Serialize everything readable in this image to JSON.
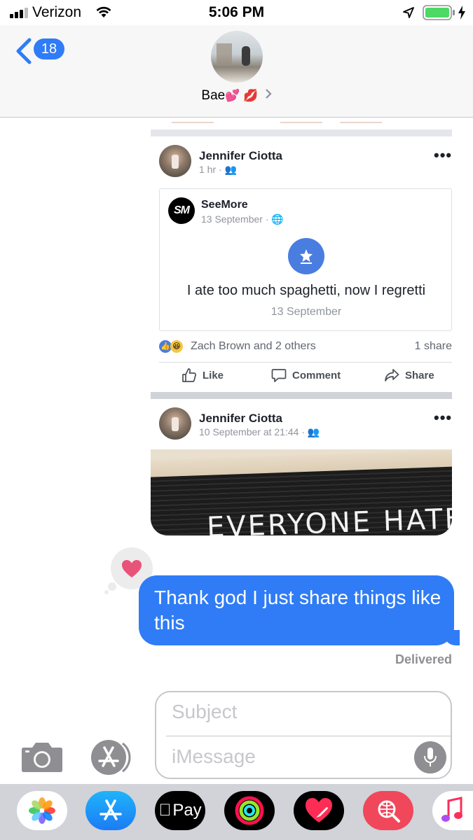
{
  "status_bar": {
    "carrier": "Verizon",
    "time": "5:06 PM"
  },
  "nav": {
    "back_count": "18",
    "contact_name": "Bae",
    "contact_emoji": "💕 💋"
  },
  "post1": {
    "author": "Jennifer Ciotta",
    "time": "1 hr ·",
    "shared": {
      "source": "SeeMore",
      "logo_text": "SM",
      "date": "13 September ·",
      "headline": "I ate too much spaghetti, now I regretti",
      "subdate": "13 September"
    },
    "reactions_text": "Zach Brown and 2 others",
    "shares_text": "1 share",
    "actions": {
      "like": "Like",
      "comment": "Comment",
      "share": "Share"
    }
  },
  "post2": {
    "author": "Jennifer Ciotta",
    "time": "10 September at 21:44 ·",
    "image_text": "EVERYONE HATES"
  },
  "message": {
    "text": "Thank god I just share things like this",
    "status": "Delivered"
  },
  "composer": {
    "subject_placeholder": "Subject",
    "message_placeholder": "iMessage"
  },
  "dock": {
    "applepay_label": "Pay"
  },
  "colors": {
    "imessage_blue": "#2f7cf6",
    "facebook_blue": "#4267b2",
    "tapback_pink": "#e8537a"
  }
}
